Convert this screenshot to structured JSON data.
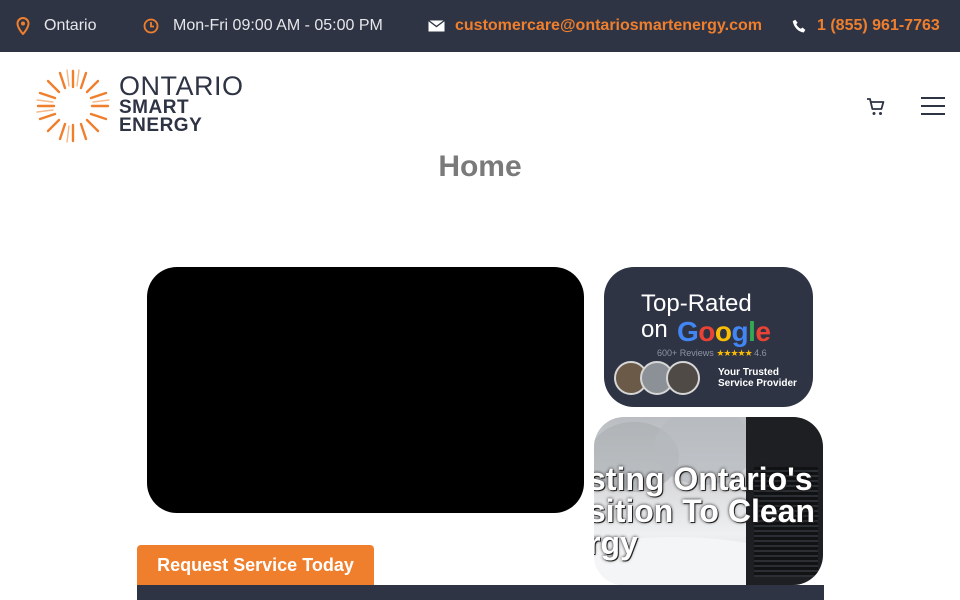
{
  "topbar": {
    "location": {
      "icon": "map-pin-icon",
      "text": "Ontario"
    },
    "hours": {
      "icon": "clock-icon",
      "text": "Mon-Fri 09:00 AM - 05:00 PM"
    },
    "email": {
      "icon": "envelope-icon",
      "text": "customercare@ontariosmartenergy.com"
    },
    "phone": {
      "icon": "phone-icon",
      "text": "1 (855) 961-7763"
    }
  },
  "logo": {
    "line1": "ONTARIO",
    "line2": "SMART",
    "line3": "ENERGY"
  },
  "header": {
    "cart_icon": "cart-icon",
    "menu_icon": "hamburger-menu-icon"
  },
  "page": {
    "title": "Home"
  },
  "rating_card": {
    "line1": "Top-Rated",
    "line2": "on",
    "brand": {
      "g1": "G",
      "o1": "o",
      "o2": "o",
      "g2": "g",
      "l": "l",
      "e": "e"
    },
    "reviews": "600+ Reviews",
    "stars": "★★★★★",
    "score": "4.6",
    "tagline1": "Your Trusted",
    "tagline2": "Service Provider"
  },
  "promo_card": {
    "line1": "sting Ontario's",
    "line2": "sition To Clean",
    "line3": "rgy"
  },
  "cta": {
    "label": "Request Service Today"
  },
  "colors": {
    "accent": "#f07f2d",
    "dark": "#2f3444"
  }
}
